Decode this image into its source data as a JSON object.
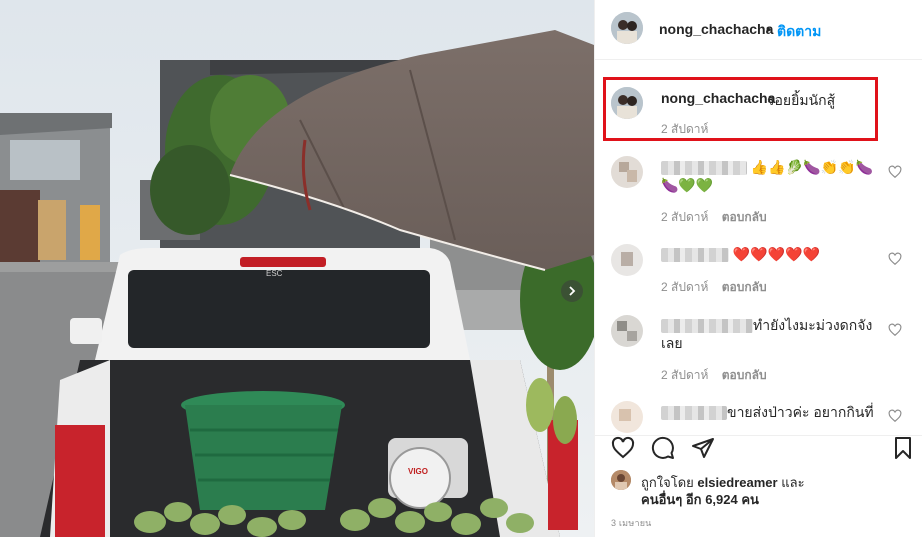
{
  "post": {
    "username": "nong_chachacha",
    "separator": "•",
    "follow_label": "ติดตาม"
  },
  "caption": {
    "username": "nong_chachacha",
    "text": "รอยยิ้มนักสู้",
    "time": "2 สัปดาห์"
  },
  "comments": [
    {
      "text_visible": "",
      "emoji": "👍👍🥬🍆👏👏🍆🍆💚💚",
      "time": "2 สัปดาห์",
      "reply_label": "ตอบกลับ"
    },
    {
      "text_visible": "",
      "emoji": "❤️❤️❤️❤️❤️",
      "time": "2 สัปดาห์",
      "reply_label": "ตอบกลับ"
    },
    {
      "text_visible": "ทำยังไงมะม่วงดกจังเลย",
      "emoji": "",
      "time": "2 สัปดาห์",
      "reply_label": "ตอบกลับ"
    },
    {
      "text_visible": "ขายส่งป่าวค่ะ อยากกินที่",
      "emoji": "",
      "time": "",
      "reply_label": ""
    }
  ],
  "likes": {
    "prefix": "ถูกใจโดย",
    "liker": "elsiedreamer",
    "and": "และ",
    "others_prefix": "คนอื่นๆ อีก",
    "count": "6,924 คน"
  },
  "post_date": "3 เมษายน",
  "photo_caption": {
    "scale_brand": "VIGO",
    "tailgate_text": "ESC"
  },
  "icons": {
    "like": "heart-icon",
    "comment": "comment-bubble-icon",
    "share": "paper-plane-icon",
    "save": "bookmark-icon",
    "next": "chevron-right-icon"
  },
  "colors": {
    "follow": "#0095f6",
    "highlight_border": "#e0121a",
    "secondary_text": "#8e8e8e"
  }
}
